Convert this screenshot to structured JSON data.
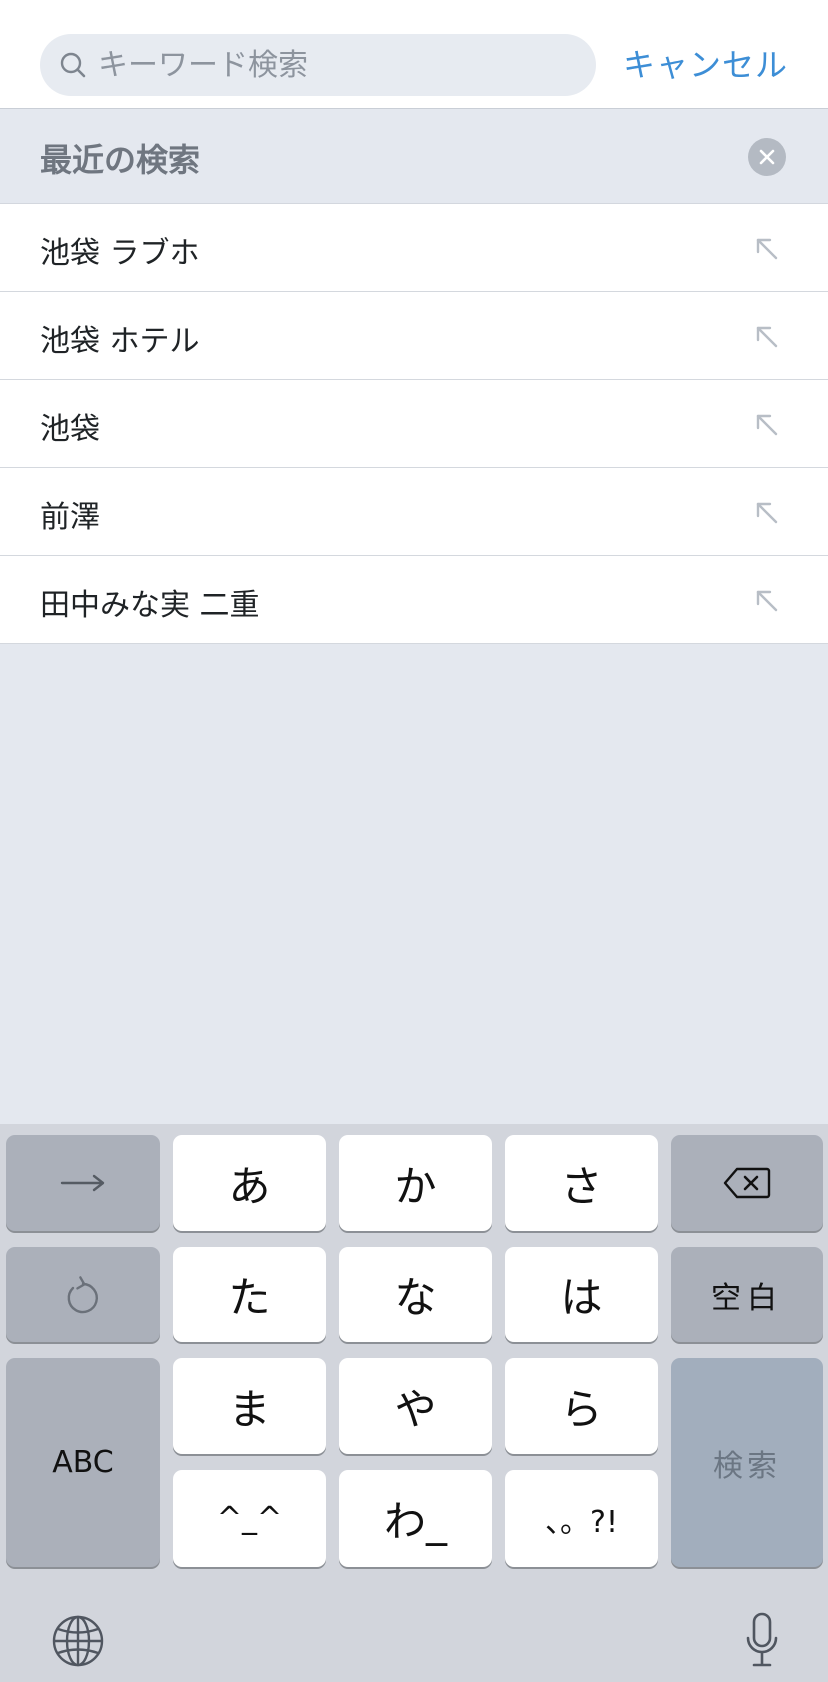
{
  "search": {
    "placeholder": "キーワード検索",
    "value": "",
    "cancel_label": "キャンセル"
  },
  "recent": {
    "title": "最近の検索",
    "items": [
      {
        "label": "池袋 ラブホ"
      },
      {
        "label": "池袋 ホテル"
      },
      {
        "label": "池袋"
      },
      {
        "label": "前澤"
      },
      {
        "label": "田中みな実 二重"
      }
    ]
  },
  "keyboard": {
    "keys": {
      "a": "あ",
      "ka": "か",
      "sa": "さ",
      "ta": "た",
      "na": "な",
      "ha": "は",
      "ma": "ま",
      "ya": "や",
      "ra": "ら",
      "kaomoji": "^_^",
      "wa": "わ_",
      "punct": "、。?!",
      "space": "空白",
      "abc": "ABC",
      "search": "検索"
    },
    "icons": {
      "next": "arrow-right-icon",
      "undo": "undo-icon",
      "delete": "backspace-icon",
      "globe": "globe-icon",
      "mic": "microphone-icon"
    }
  },
  "colors": {
    "accent": "#3d8ed6",
    "background": "#e4e8ef",
    "keyboard": "#d2d5dc"
  }
}
